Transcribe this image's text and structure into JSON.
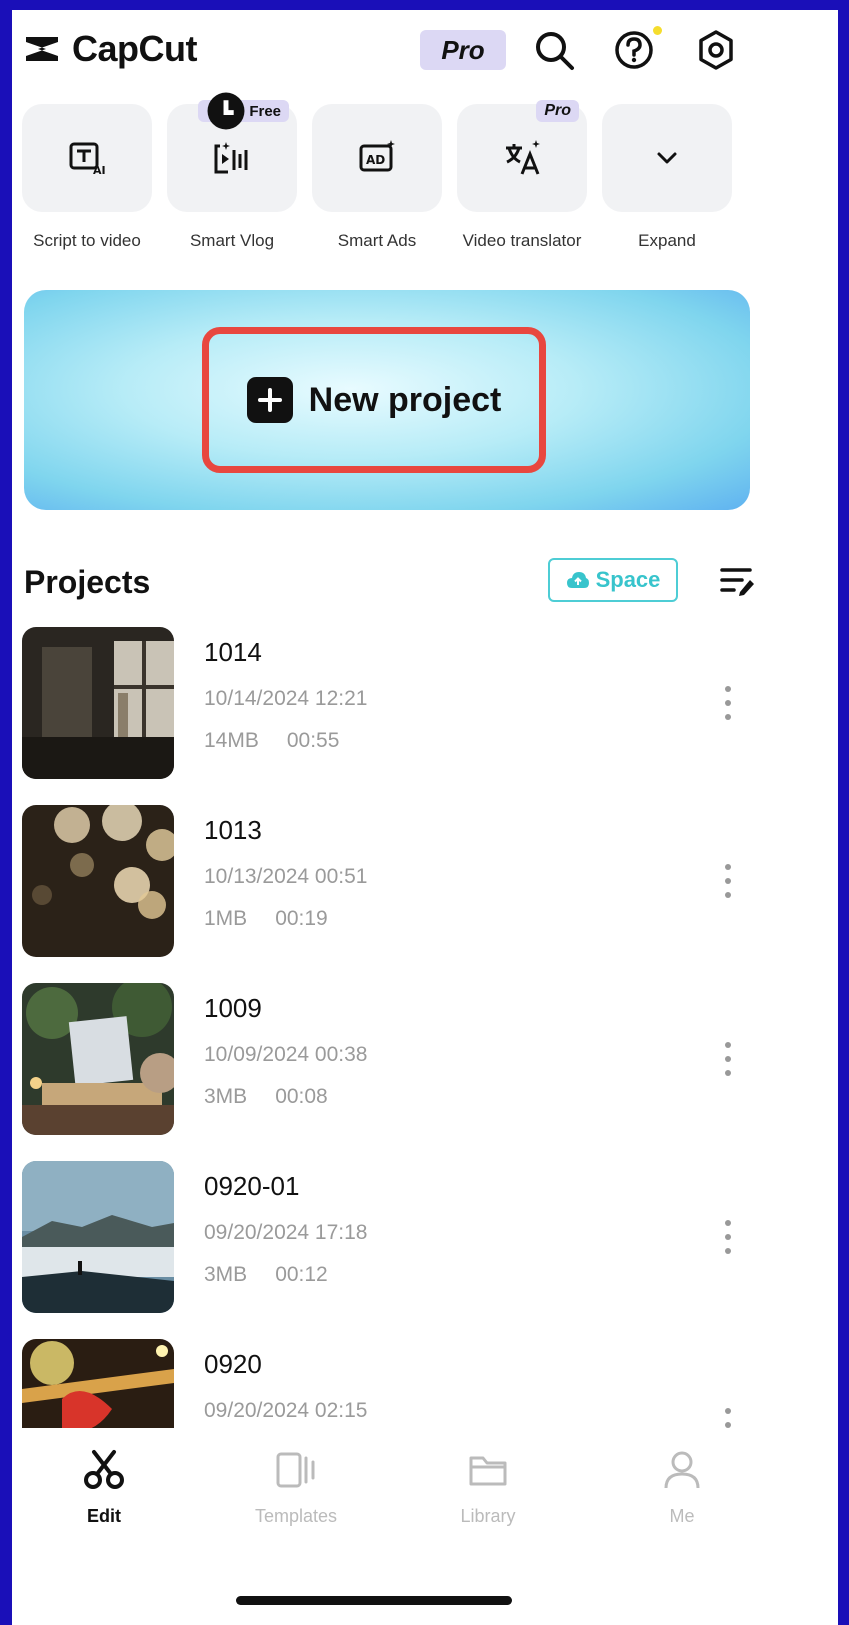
{
  "app": {
    "name": "CapCut",
    "pro_badge": "Pro"
  },
  "header": {
    "icons": [
      "search-icon",
      "help-icon",
      "settings-icon"
    ]
  },
  "tools": [
    {
      "label": "Script to video",
      "icon": "script-ai-icon",
      "tag": ""
    },
    {
      "label": "Smart Vlog",
      "icon": "smart-vlog-icon",
      "tag": "Free"
    },
    {
      "label": "Smart Ads",
      "icon": "smart-ads-icon",
      "tag": ""
    },
    {
      "label": "Video translator",
      "icon": "translate-icon",
      "tag": "Pro"
    },
    {
      "label": "Expand",
      "icon": "chevron-down-icon",
      "tag": ""
    }
  ],
  "banner": {
    "label": "New project"
  },
  "projects": {
    "title": "Projects",
    "space_label": "Space",
    "items": [
      {
        "name": "1014",
        "date": "10/14/2024 12:21",
        "size": "14MB",
        "duration": "00:55"
      },
      {
        "name": "1013",
        "date": "10/13/2024 00:51",
        "size": "1MB",
        "duration": "00:19"
      },
      {
        "name": "1009",
        "date": "10/09/2024 00:38",
        "size": "3MB",
        "duration": "00:08"
      },
      {
        "name": "0920-01",
        "date": "09/20/2024 17:18",
        "size": "3MB",
        "duration": "00:12"
      },
      {
        "name": "0920",
        "date": "09/20/2024 02:15",
        "size": "",
        "duration": ""
      }
    ]
  },
  "tabs": [
    {
      "label": "Edit",
      "icon": "scissors-icon",
      "active": true
    },
    {
      "label": "Templates",
      "icon": "templates-icon",
      "active": false
    },
    {
      "label": "Library",
      "icon": "folder-icon",
      "active": false
    },
    {
      "label": "Me",
      "icon": "person-icon",
      "active": false
    }
  ],
  "colors": {
    "frame": "#1a0fb8",
    "highlight": "#e8473f",
    "space": "#38c4cc",
    "pro_badge_bg": "#dcd8f4"
  }
}
